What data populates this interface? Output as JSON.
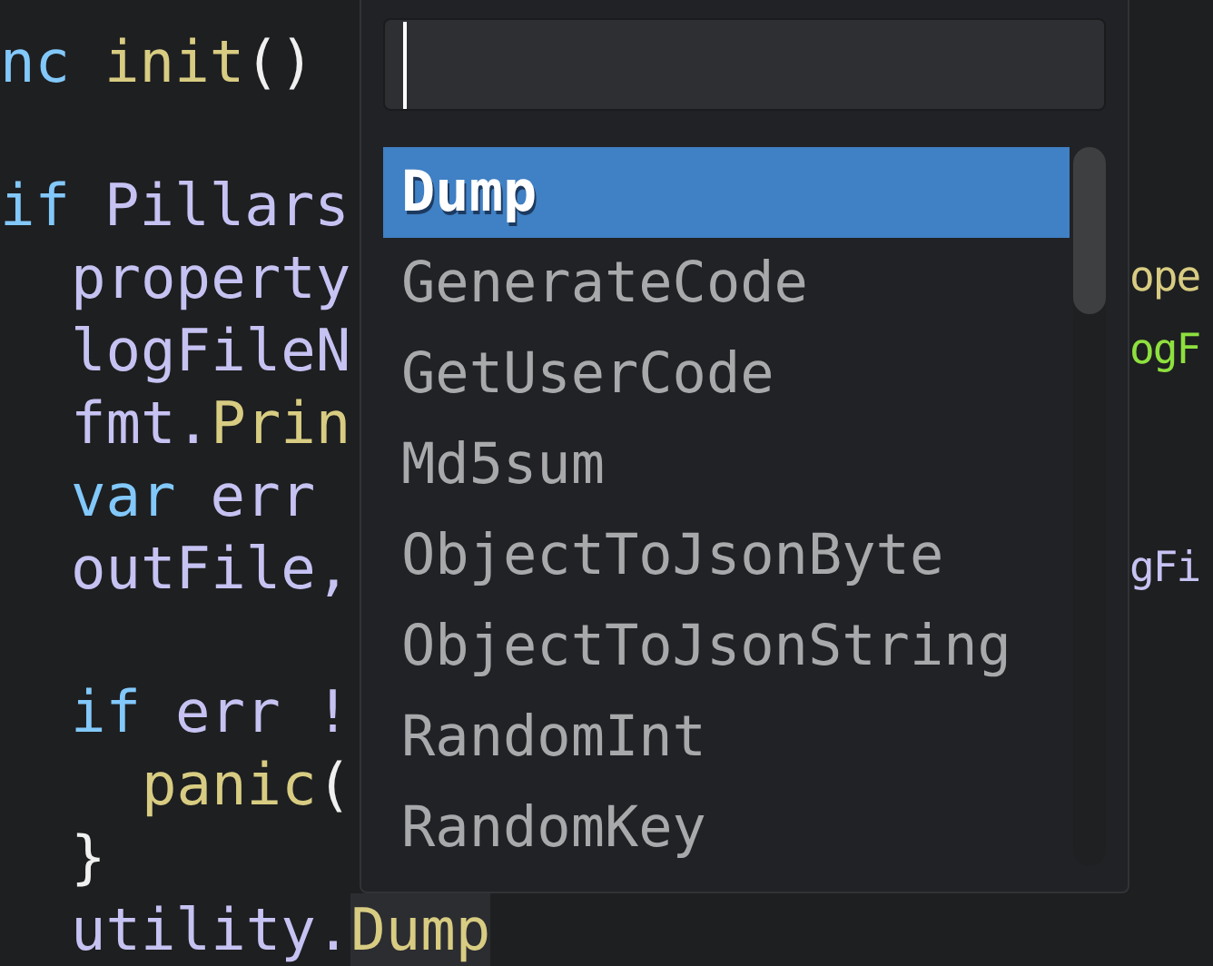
{
  "code_lines": [
    {
      "kind": "top",
      "left": [
        {
          "parts": [
            {
              "kind": "keyword",
              "text": "nc"
            }
          ]
        },
        {
          "parts": [
            {
              "kind": "func",
              "text": "init"
            },
            {
              "kind": "punct",
              "text": "()"
            }
          ]
        }
      ]
    },
    {
      "kind": "blank"
    },
    {
      "kind": "top",
      "left": [
        {
          "parts": [
            {
              "kind": "keyword",
              "text": "if"
            }
          ]
        },
        {
          "parts": [
            {
              "kind": "ident",
              "text": "Pillars"
            }
          ]
        }
      ]
    },
    {
      "kind": "block",
      "left": [
        {
          "parts": [
            {
              "kind": "ident",
              "text": "property"
            }
          ]
        }
      ],
      "right": [
        {
          "parts": [
            {
              "kind": "func",
              "text": "ope"
            }
          ]
        }
      ]
    },
    {
      "kind": "block",
      "left": [
        {
          "parts": [
            {
              "kind": "ident",
              "text": "logFileN"
            }
          ]
        }
      ],
      "right": [
        {
          "parts": [
            {
              "kind": "string",
              "text": "ogF"
            }
          ]
        }
      ]
    },
    {
      "kind": "block",
      "left": [
        {
          "parts": [
            {
              "kind": "ident",
              "text": "fmt."
            },
            {
              "kind": "func",
              "text": "Prin"
            }
          ]
        }
      ]
    },
    {
      "kind": "block",
      "left": [
        {
          "parts": [
            {
              "kind": "keyword",
              "text": "var"
            }
          ]
        },
        {
          "parts": [
            {
              "kind": "ident",
              "text": "err"
            }
          ]
        }
      ]
    },
    {
      "kind": "block",
      "left": [
        {
          "parts": [
            {
              "kind": "ident",
              "text": "outFile,"
            }
          ]
        }
      ],
      "right": [
        {
          "parts": [
            {
              "kind": "ident",
              "text": "gFi"
            }
          ]
        }
      ]
    },
    {
      "kind": "blank"
    },
    {
      "kind": "block",
      "left": [
        {
          "parts": [
            {
              "kind": "keyword",
              "text": "if"
            }
          ]
        },
        {
          "parts": [
            {
              "kind": "ident",
              "text": "err !"
            }
          ]
        }
      ]
    },
    {
      "kind": "nested",
      "left": [
        {
          "parts": [
            {
              "kind": "func",
              "text": "panic"
            },
            {
              "kind": "punct",
              "text": "("
            }
          ]
        }
      ]
    },
    {
      "kind": "block",
      "left": [
        {
          "parts": [
            {
              "kind": "punct",
              "text": "}"
            }
          ]
        }
      ]
    },
    {
      "kind": "block",
      "left": [
        {
          "parts": [
            {
              "kind": "ident",
              "text": "utility."
            },
            {
              "kind": "match",
              "text": "Dump"
            }
          ]
        }
      ]
    }
  ],
  "popup": {
    "items": [
      {
        "label": "Dump",
        "selected": true
      },
      {
        "label": "GenerateCode",
        "selected": false
      },
      {
        "label": "GetUserCode",
        "selected": false
      },
      {
        "label": "Md5sum",
        "selected": false
      },
      {
        "label": "ObjectToJsonByte",
        "selected": false
      },
      {
        "label": "ObjectToJsonString",
        "selected": false
      },
      {
        "label": "RandomInt",
        "selected": false
      },
      {
        "label": "RandomKey",
        "selected": false
      }
    ]
  }
}
